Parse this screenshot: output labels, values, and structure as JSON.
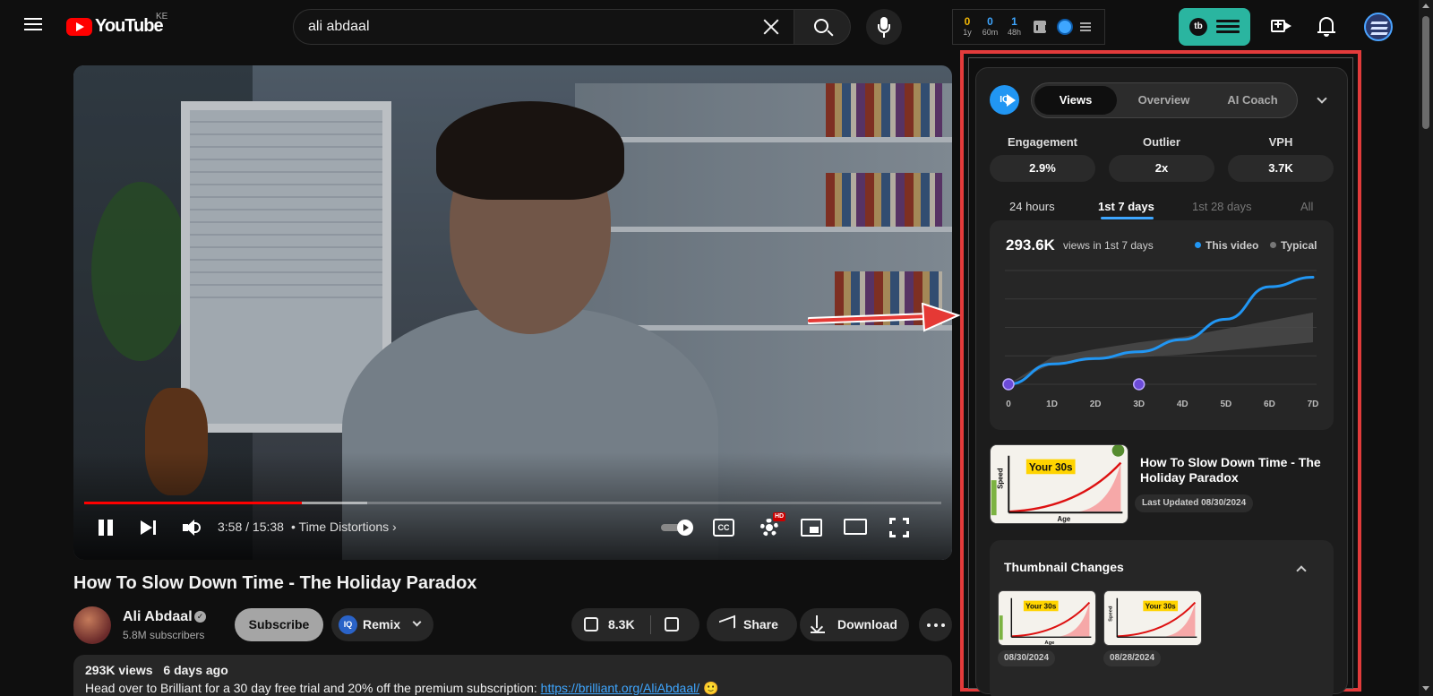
{
  "header": {
    "logo_text": "YouTube",
    "country_code": "KE",
    "search_value": "ali abdaal",
    "search_placeholder": "Search",
    "stats": [
      {
        "value": "0",
        "label": "1y"
      },
      {
        "value": "0",
        "label": "60m"
      },
      {
        "value": "1",
        "label": "48h"
      }
    ],
    "tb_logo": "tb"
  },
  "player": {
    "current_time": "3:58",
    "duration": "15:38",
    "time_display": "3:58 / 15:38",
    "chapter": "• Time Distortions",
    "progress_fraction": 0.254,
    "buffer_fraction": 0.33,
    "cc_label": "CC",
    "hd_label": "HD",
    "autoplay_on": true
  },
  "video": {
    "title": "How To Slow Down Time - The Holiday Paradox",
    "channel_name": "Ali Abdaal",
    "subscribers": "5.8M subscribers",
    "subscribe_label": "Subscribe",
    "remix_label": "Remix",
    "remix_logo": "IQ",
    "likes": "8.3K",
    "share_label": "Share",
    "download_label": "Download",
    "views": "293K views",
    "published": "6 days ago",
    "description_text": "Head over to Brilliant for a 30 day free trial and 20% off the premium subscription: ",
    "description_link": "https://brilliant.org/AliAbdaal/",
    "description_emoji": " 🙂"
  },
  "panel": {
    "logo_text": "IQ",
    "tabs": [
      {
        "label": "Views",
        "active": true
      },
      {
        "label": "Overview",
        "active": false
      },
      {
        "label": "AI Coach",
        "active": false
      }
    ],
    "metrics": [
      {
        "label": "Engagement",
        "value": "2.9%"
      },
      {
        "label": "Outlier",
        "value": "2x"
      },
      {
        "label": "VPH",
        "value": "3.7K"
      }
    ],
    "ranges": [
      {
        "label": "24 hours",
        "state": "normal"
      },
      {
        "label": "1st 7 days",
        "state": "active"
      },
      {
        "label": "1st 28 days",
        "state": "disabled"
      },
      {
        "label": "All",
        "state": "disabled"
      }
    ],
    "chart_total": "293.6K",
    "chart_caption": "views in 1st 7 days",
    "legend_this": "This video",
    "legend_typical": "Typical",
    "video_card_title": "How To Slow Down Time - The Holiday Paradox",
    "last_updated": "Last Updated 08/30/2024",
    "thumbnail_changes_title": "Thumbnail Changes",
    "thumbnail_changes": [
      {
        "date": "08/30/2024"
      },
      {
        "date": "08/28/2024"
      }
    ],
    "thumb_text": {
      "highlight": "Your 30s",
      "y_label": "Speed",
      "x_label": "Age"
    }
  },
  "chart_data": {
    "type": "line",
    "categories": [
      "0",
      "1D",
      "2D",
      "3D",
      "4D",
      "5D",
      "6D",
      "7D"
    ],
    "series": [
      {
        "name": "This video",
        "values": [
          0,
          75,
          95,
          120,
          165,
          240,
          360,
          395
        ],
        "color": "#2196f3"
      },
      {
        "name": "Typical",
        "upper": [
          0,
          100,
          130,
          155,
          175,
          205,
          235,
          265
        ],
        "lower": [
          0,
          75,
          90,
          100,
          110,
          125,
          140,
          155
        ],
        "color": "#555555"
      }
    ],
    "ylim": [
      0,
      420
    ],
    "markers_at": [
      "0",
      "3D"
    ],
    "grid": true,
    "legend_position": "top-right",
    "colors": {
      "line": "#2196f3",
      "band": "#4a4a4a",
      "marker": "#6c4bd8"
    }
  }
}
